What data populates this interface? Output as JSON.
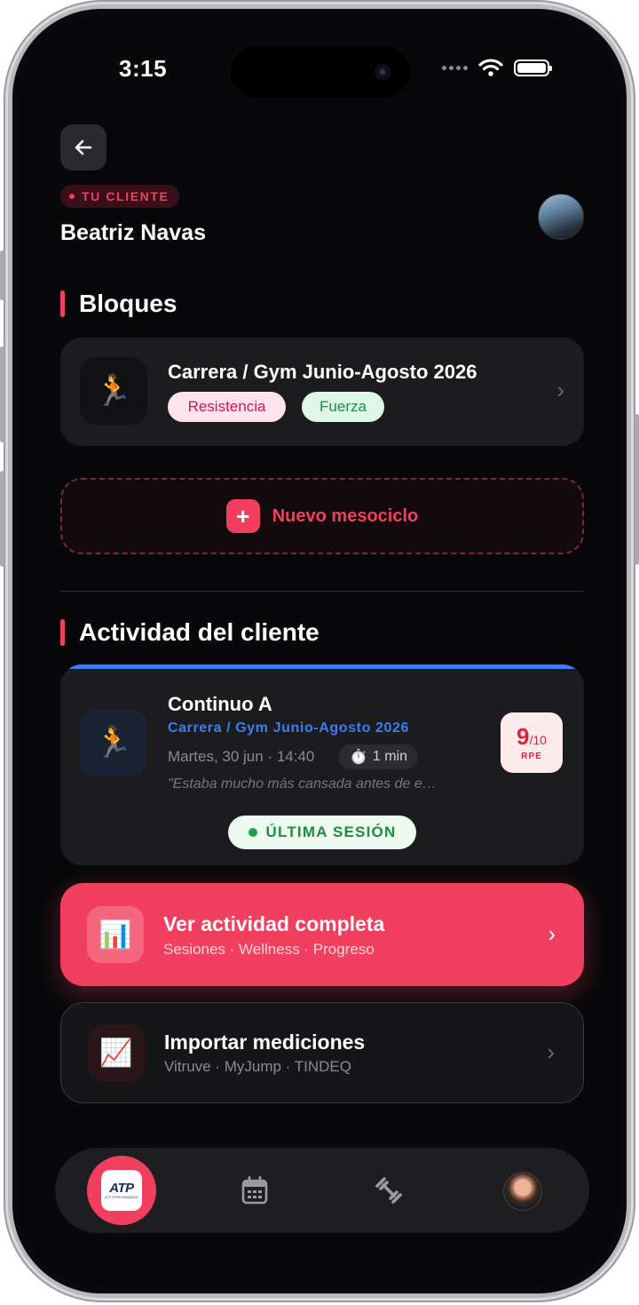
{
  "status_bar": {
    "time": "3:15"
  },
  "header": {
    "client_tag": "TU CLIENTE",
    "client_name": "Beatriz Navas"
  },
  "bloques": {
    "title": "Bloques",
    "card": {
      "icon": "🏃",
      "title": "Carrera / Gym Junio-Agosto 2026",
      "tags": [
        {
          "label": "Resistencia",
          "bg": "#fde4ec",
          "color": "#c81b57"
        },
        {
          "label": "Fuerza",
          "bg": "#dff7e8",
          "color": "#1e8d41"
        }
      ]
    },
    "new_button": {
      "plus": "+",
      "label": "Nuevo mesociclo"
    }
  },
  "actividad": {
    "title": "Actividad del cliente",
    "session": {
      "icon": "🏃",
      "title": "Continuo A",
      "block": "Carrera / Gym Junio-Agosto 2026",
      "date": "Martes, 30 jun · 14:40",
      "duration_icon": "⏱️",
      "duration": "1 min",
      "note": "\"Estaba mucho más cansada antes de e…",
      "rpe_value": "9",
      "rpe_max": "/10",
      "rpe_label": "RPE",
      "badge": "ÚLTIMA SESIÓN"
    },
    "view_all": {
      "icon": "📊",
      "title": "Ver actividad completa",
      "subtitle": "Sesiones · Wellness · Progreso"
    },
    "import": {
      "icon": "📈",
      "title": "Importar mediciones",
      "subtitle": "Vitruve · MyJump · TINDEQ"
    }
  },
  "tabbar": {
    "home_logo": "ATP",
    "home_logo_sub": "ATP PERFORMANCE",
    "tabs": [
      "calendar-icon",
      "dumbbell-icon",
      "profile-avatar"
    ]
  },
  "colors": {
    "accent": "#f23e5f",
    "blue": "#3d7df0",
    "background": "#08080a",
    "card": "#1c1c1f"
  }
}
